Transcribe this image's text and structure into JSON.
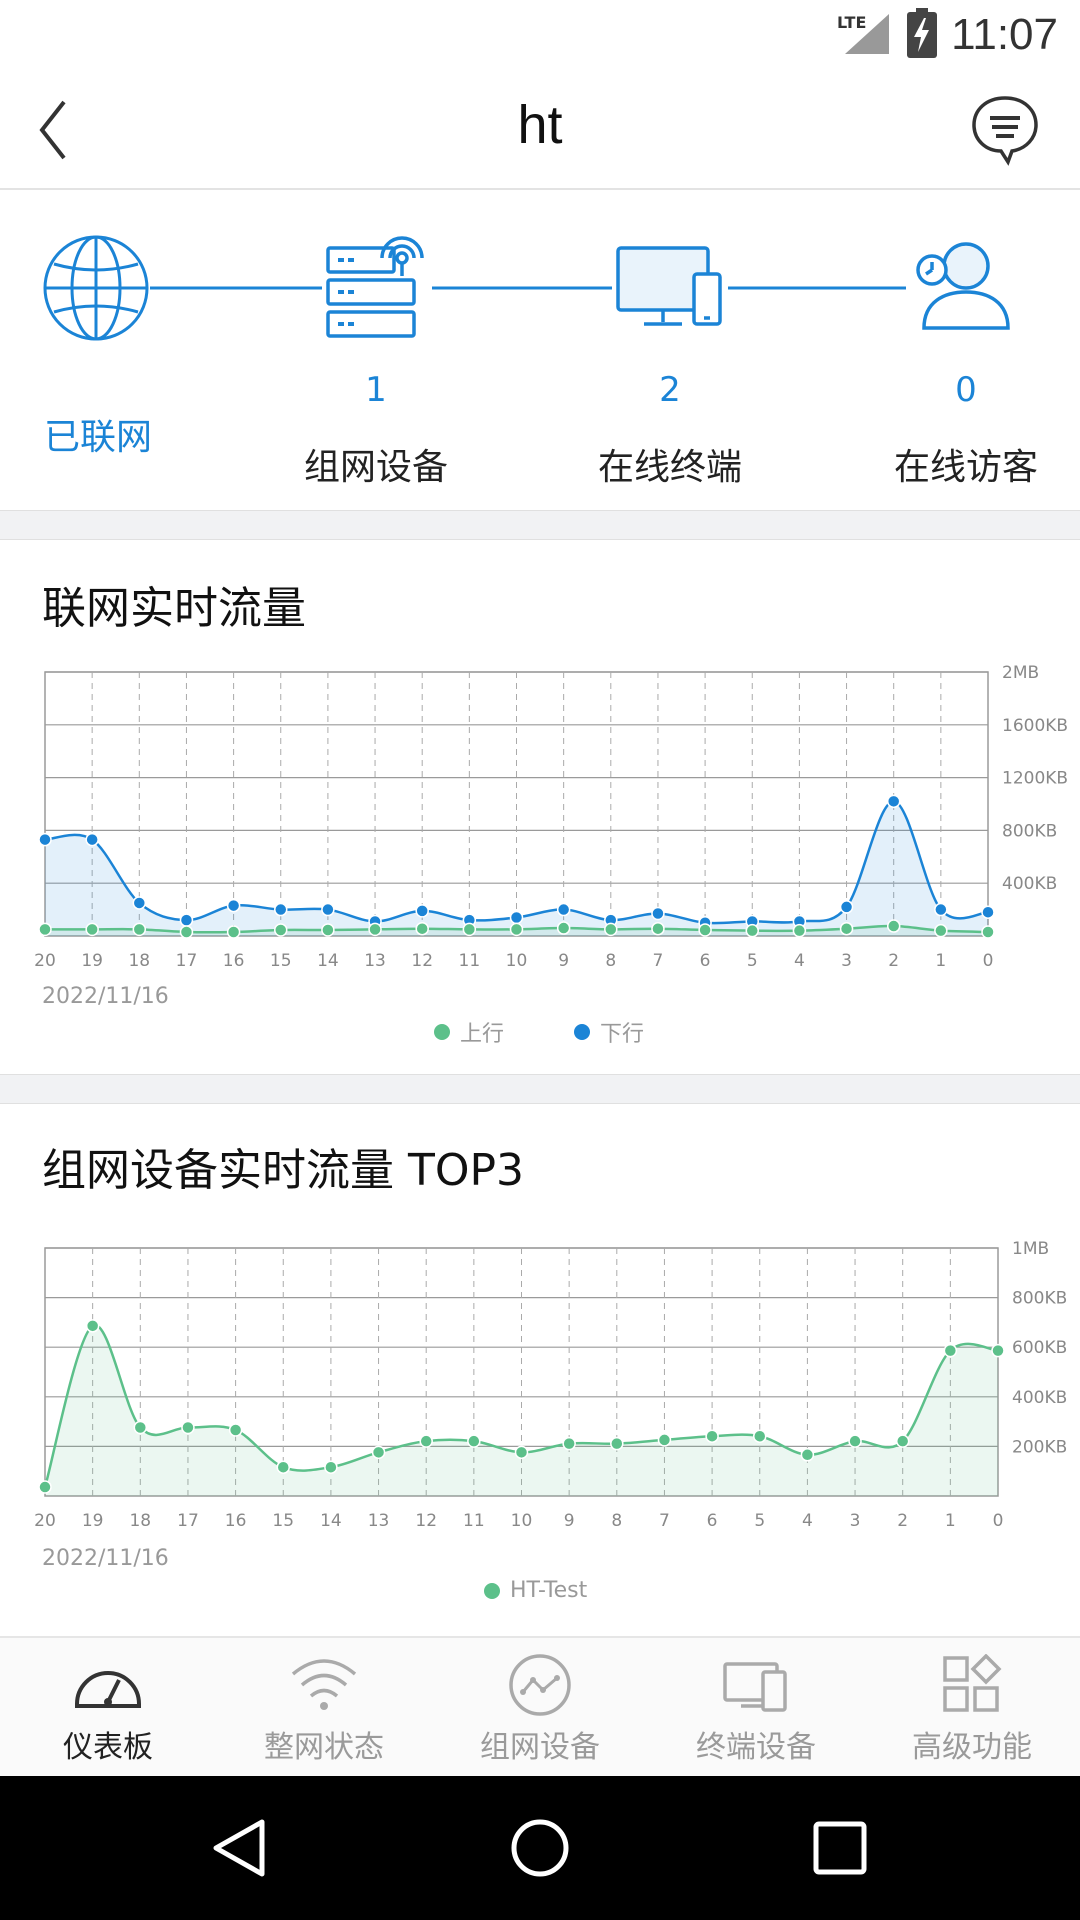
{
  "status": {
    "network": "LTE",
    "time": "11:07"
  },
  "header": {
    "title": "ht"
  },
  "network": {
    "online_label": "已联网",
    "mesh_count": "1",
    "mesh_label": "组网设备",
    "terminal_count": "2",
    "terminal_label": "在线终端",
    "guest_count": "0",
    "guest_label": "在线访客"
  },
  "traffic": {
    "title": "联网实时流量",
    "date": "2022/11/16",
    "legend_up": "上行",
    "legend_down": "下行"
  },
  "top3": {
    "title": "组网设备实时流量 TOP3",
    "date": "2022/11/16",
    "legend": "HT-Test"
  },
  "colors": {
    "blue": "#1b84d6",
    "green": "#5cc08a"
  },
  "nav": [
    {
      "label": "仪表板",
      "icon": "dashboard-icon"
    },
    {
      "label": "整网状态",
      "icon": "wifi-icon"
    },
    {
      "label": "组网设备",
      "icon": "mesh-icon"
    },
    {
      "label": "终端设备",
      "icon": "devices-icon"
    },
    {
      "label": "高级功能",
      "icon": "apps-icon"
    }
  ],
  "chart_data": [
    {
      "type": "line",
      "title": "联网实时流量",
      "x": [
        "20",
        "19",
        "18",
        "17",
        "16",
        "15",
        "14",
        "13",
        "12",
        "11",
        "10",
        "9",
        "8",
        "7",
        "6",
        "5",
        "4",
        "3",
        "2",
        "1",
        "0"
      ],
      "y_ticks": [
        "2MB",
        "1600KB",
        "1200KB",
        "800KB",
        "400KB"
      ],
      "ylim": [
        0,
        2000
      ],
      "series": [
        {
          "name": "上行",
          "color": "#5cc08a",
          "values": [
            20,
            20,
            20,
            0,
            0,
            15,
            15,
            20,
            25,
            20,
            20,
            30,
            20,
            25,
            15,
            10,
            10,
            25,
            45,
            10,
            0
          ]
        },
        {
          "name": "下行",
          "color": "#1b84d6",
          "values": [
            700,
            700,
            220,
            90,
            200,
            170,
            170,
            80,
            160,
            90,
            110,
            170,
            90,
            140,
            70,
            80,
            80,
            190,
            990,
            170,
            150
          ]
        }
      ]
    },
    {
      "type": "line",
      "title": "组网设备实时流量 TOP3",
      "x": [
        "20",
        "19",
        "18",
        "17",
        "16",
        "15",
        "14",
        "13",
        "12",
        "11",
        "10",
        "9",
        "8",
        "7",
        "6",
        "5",
        "4",
        "3",
        "2",
        "1",
        "0"
      ],
      "y_ticks": [
        "1MB",
        "800KB",
        "600KB",
        "400KB",
        "200KB"
      ],
      "ylim": [
        0,
        1000
      ],
      "series": [
        {
          "name": "HT-Test",
          "color": "#5cc08a",
          "values": [
            20,
            670,
            260,
            260,
            250,
            100,
            100,
            160,
            205,
            205,
            160,
            195,
            195,
            210,
            225,
            225,
            150,
            205,
            205,
            570,
            570
          ]
        }
      ]
    }
  ]
}
